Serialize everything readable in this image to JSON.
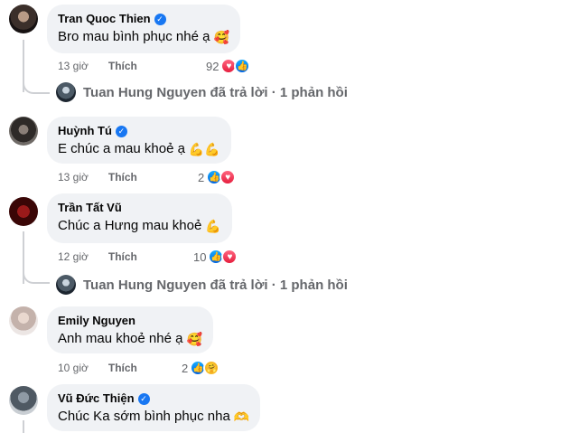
{
  "comments": [
    {
      "name": "Tran Quoc Thien",
      "verified": true,
      "text": "Bro mau bình phục nhé ạ",
      "emoji": "🥰",
      "time": "13 giờ",
      "like_label": "Thích",
      "reaction_count": "92",
      "reactions": [
        "love",
        "like"
      ],
      "reply_summary": {
        "name": "Tuan Hung Nguyen",
        "text": "Tuan Hung Nguyen đã trả lời · 1 phản hồi"
      }
    },
    {
      "name": "Huỳnh Tú",
      "verified": true,
      "text": "E chúc a mau khoẻ ạ",
      "emoji": "💪💪",
      "time": "13 giờ",
      "like_label": "Thích",
      "reaction_count": "2",
      "reactions": [
        "like",
        "love"
      ]
    },
    {
      "name": "Trần Tất Vũ",
      "verified": false,
      "text": "Chúc a Hưng mau khoẻ",
      "emoji": "💪",
      "time": "12 giờ",
      "like_label": "Thích",
      "reaction_count": "10",
      "reactions": [
        "like",
        "love"
      ],
      "reply_summary": {
        "name": "Tuan Hung Nguyen",
        "text": "Tuan Hung Nguyen đã trả lời · 1 phản hồi"
      }
    },
    {
      "name": "Emily Nguyen",
      "verified": false,
      "text": "Anh mau khoẻ nhé ạ",
      "emoji": "🥰",
      "time": "10 giờ",
      "like_label": "Thích",
      "reaction_count": "2",
      "reactions": [
        "like",
        "care"
      ]
    },
    {
      "name": "Vũ Đức Thiện",
      "verified": true,
      "text": "Chúc Ka sớm bình phục nha",
      "emoji": "🫶"
    }
  ],
  "icons": {
    "verified": "✓",
    "like": "👍",
    "love": "♥",
    "care": "🤗"
  },
  "colors": {
    "verified_blue": "#1877f2",
    "bubble_bg": "#f0f2f5",
    "secondary_text": "#65676b"
  }
}
